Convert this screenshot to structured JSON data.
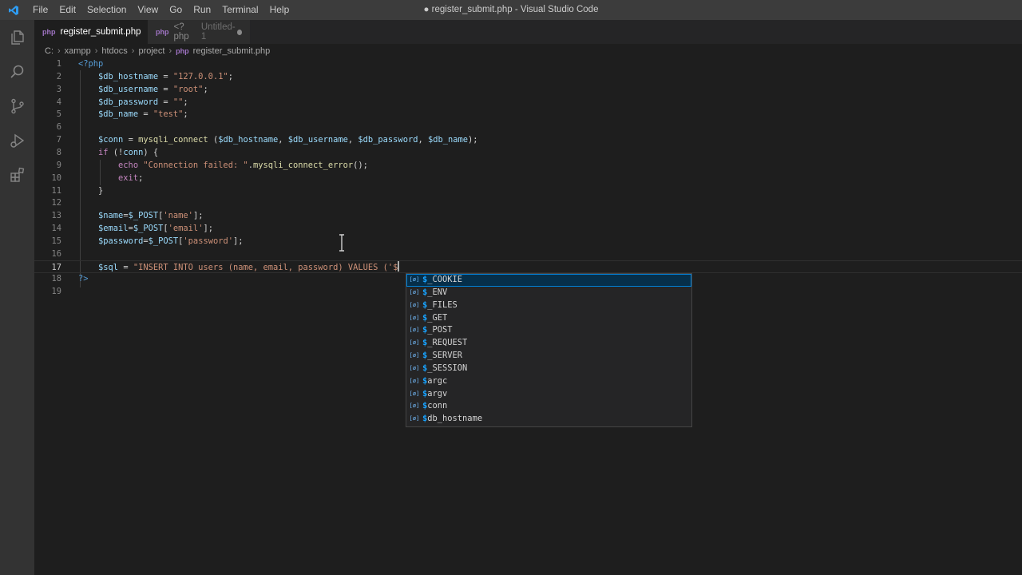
{
  "window": {
    "title": "● register_submit.php - Visual Studio Code",
    "menu": [
      "File",
      "Edit",
      "Selection",
      "View",
      "Go",
      "Run",
      "Terminal",
      "Help"
    ]
  },
  "activity_bar": {
    "items": [
      "explorer-icon",
      "search-icon",
      "source-control-icon",
      "run-debug-icon",
      "extensions-icon"
    ]
  },
  "tabs": [
    {
      "icon": "php-file-icon",
      "label": "register_submit.php",
      "description": "",
      "modified": true,
      "active": true
    },
    {
      "icon": "php-file-icon",
      "label": "<?php",
      "description": "Untitled-1",
      "modified": true,
      "active": false
    }
  ],
  "breadcrumb": [
    "C:",
    "xampp",
    "htdocs",
    "project",
    "register_submit.php"
  ],
  "editor": {
    "current_line": 17,
    "lines": [
      {
        "n": "1",
        "tokens": [
          [
            "tag",
            "<?php"
          ]
        ]
      },
      {
        "n": "2",
        "tokens": [
          [
            "op",
            "    "
          ],
          [
            "var",
            "$db_hostname"
          ],
          [
            "op",
            " = "
          ],
          [
            "str",
            "\"127.0.0.1\""
          ],
          [
            "op",
            ";"
          ]
        ]
      },
      {
        "n": "3",
        "tokens": [
          [
            "op",
            "    "
          ],
          [
            "var",
            "$db_username"
          ],
          [
            "op",
            " = "
          ],
          [
            "str",
            "\"root\""
          ],
          [
            "op",
            ";"
          ]
        ]
      },
      {
        "n": "4",
        "tokens": [
          [
            "op",
            "    "
          ],
          [
            "var",
            "$db_password"
          ],
          [
            "op",
            " = "
          ],
          [
            "str",
            "\"\""
          ],
          [
            "op",
            ";"
          ]
        ]
      },
      {
        "n": "5",
        "tokens": [
          [
            "op",
            "    "
          ],
          [
            "var",
            "$db_name"
          ],
          [
            "op",
            " = "
          ],
          [
            "str",
            "\"test\""
          ],
          [
            "op",
            ";"
          ]
        ]
      },
      {
        "n": "6",
        "tokens": []
      },
      {
        "n": "7",
        "tokens": [
          [
            "op",
            "    "
          ],
          [
            "var",
            "$conn"
          ],
          [
            "op",
            " = "
          ],
          [
            "fn",
            "mysqli_connect"
          ],
          [
            "op",
            " ("
          ],
          [
            "var",
            "$db_hostname"
          ],
          [
            "op",
            ", "
          ],
          [
            "var",
            "$db_username"
          ],
          [
            "op",
            ", "
          ],
          [
            "var",
            "$db_password"
          ],
          [
            "op",
            ", "
          ],
          [
            "var",
            "$db_name"
          ],
          [
            "op",
            ");"
          ]
        ]
      },
      {
        "n": "8",
        "tokens": [
          [
            "op",
            "    "
          ],
          [
            "kw",
            "if"
          ],
          [
            "op",
            " (!"
          ],
          [
            "var",
            "conn"
          ],
          [
            "op",
            ") {"
          ]
        ]
      },
      {
        "n": "9",
        "tokens": [
          [
            "op",
            "        "
          ],
          [
            "kw",
            "echo"
          ],
          [
            "op",
            " "
          ],
          [
            "str",
            "\"Connection failed: \""
          ],
          [
            "op",
            "."
          ],
          [
            "fn",
            "mysqli_connect_error"
          ],
          [
            "op",
            "();"
          ]
        ]
      },
      {
        "n": "10",
        "tokens": [
          [
            "op",
            "        "
          ],
          [
            "kw",
            "exit"
          ],
          [
            "op",
            ";"
          ]
        ]
      },
      {
        "n": "11",
        "tokens": [
          [
            "op",
            "    }"
          ]
        ]
      },
      {
        "n": "12",
        "tokens": []
      },
      {
        "n": "13",
        "tokens": [
          [
            "op",
            "    "
          ],
          [
            "var",
            "$name"
          ],
          [
            "op",
            "="
          ],
          [
            "var",
            "$_POST"
          ],
          [
            "op",
            "["
          ],
          [
            "str",
            "'name'"
          ],
          [
            "op",
            "];"
          ]
        ]
      },
      {
        "n": "14",
        "tokens": [
          [
            "op",
            "    "
          ],
          [
            "var",
            "$email"
          ],
          [
            "op",
            "="
          ],
          [
            "var",
            "$_POST"
          ],
          [
            "op",
            "["
          ],
          [
            "str",
            "'email'"
          ],
          [
            "op",
            "];"
          ]
        ]
      },
      {
        "n": "15",
        "tokens": [
          [
            "op",
            "    "
          ],
          [
            "var",
            "$password"
          ],
          [
            "op",
            "="
          ],
          [
            "var",
            "$_POST"
          ],
          [
            "op",
            "["
          ],
          [
            "str",
            "'password'"
          ],
          [
            "op",
            "];"
          ]
        ]
      },
      {
        "n": "16",
        "tokens": []
      },
      {
        "n": "17",
        "tokens": [
          [
            "op",
            "    "
          ],
          [
            "var",
            "$sql"
          ],
          [
            "op",
            " = "
          ],
          [
            "str",
            "\"INSERT INTO users (name, email, password) VALUES ('$"
          ]
        ],
        "cursor": true
      },
      {
        "n": "18",
        "tokens": [
          [
            "tag",
            "?>"
          ]
        ]
      },
      {
        "n": "19",
        "tokens": []
      }
    ]
  },
  "suggest": {
    "icon": "variable-icon",
    "icon_text": "[ø]",
    "match": "$",
    "selected_index": 0,
    "items": [
      "_COOKIE",
      "_ENV",
      "_FILES",
      "_GET",
      "_POST",
      "_REQUEST",
      "_SERVER",
      "_SESSION",
      "argc",
      "argv",
      "conn",
      "db_hostname"
    ]
  },
  "colors": {
    "keyword": "#c586c0",
    "string": "#ce9178",
    "variable": "#9cdcfe",
    "function": "#dcdcaa",
    "tag": "#569cd6",
    "accent": "#007fd4"
  }
}
